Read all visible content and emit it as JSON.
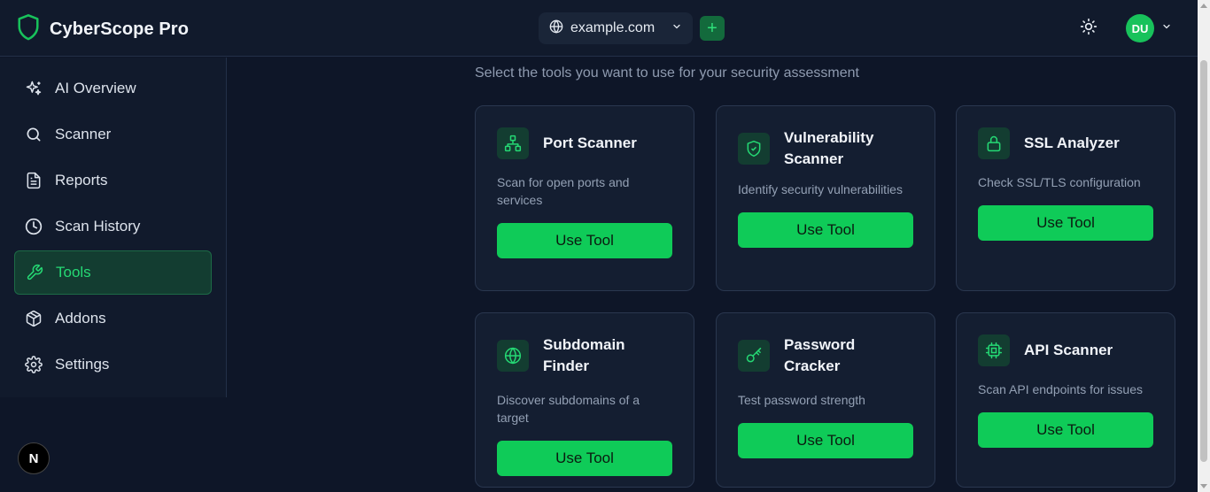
{
  "app": {
    "name": "CyberScope Pro",
    "logo_icon": "shield-icon"
  },
  "header": {
    "domain": "example.com",
    "domain_icon": "globe-icon",
    "add_label": "+",
    "theme_icon": "sun-icon",
    "user_initials": "DU"
  },
  "sidebar": {
    "items": [
      {
        "label": "AI Overview",
        "icon": "sparkles-icon",
        "active": false
      },
      {
        "label": "Scanner",
        "icon": "search-icon",
        "active": false
      },
      {
        "label": "Reports",
        "icon": "document-icon",
        "active": false
      },
      {
        "label": "Scan History",
        "icon": "clock-icon",
        "active": false
      },
      {
        "label": "Tools",
        "icon": "wrench-icon",
        "active": true
      },
      {
        "label": "Addons",
        "icon": "package-icon",
        "active": false
      },
      {
        "label": "Settings",
        "icon": "gear-icon",
        "active": false
      }
    ]
  },
  "main": {
    "subtitle": "Select the tools you want to use for your security assessment",
    "tools": [
      {
        "title": "Port Scanner",
        "desc": "Scan for open ports and services",
        "icon": "network-icon",
        "button": "Use Tool"
      },
      {
        "title": "Vulnerability Scanner",
        "desc": "Identify security vulnerabilities",
        "icon": "shield-check-icon",
        "button": "Use Tool"
      },
      {
        "title": "SSL Analyzer",
        "desc": "Check SSL/TLS configuration",
        "icon": "lock-icon",
        "button": "Use Tool"
      },
      {
        "title": "Subdomain Finder",
        "desc": "Discover subdomains of a target",
        "icon": "globe-icon",
        "button": "Use Tool"
      },
      {
        "title": "Password Cracker",
        "desc": "Test password strength",
        "icon": "key-icon",
        "button": "Use Tool"
      },
      {
        "title": "API Scanner",
        "desc": "Scan API endpoints for issues",
        "icon": "cpu-icon",
        "button": "Use Tool"
      }
    ]
  },
  "badge": "N",
  "colors": {
    "accent": "#0fcb58",
    "background": "#0e1628",
    "panel": "#111a2c",
    "card": "#141e31"
  }
}
